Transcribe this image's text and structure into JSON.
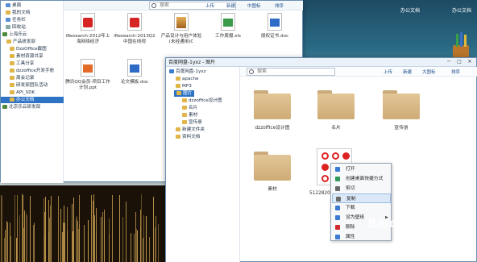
{
  "desktop": {
    "icon_label_1": "办公文档",
    "icon_label_2": "办公文档"
  },
  "win1": {
    "tree": [
      "桌面",
      "我的文档",
      "任务栏",
      "回收站",
      "上海乐云",
      "产品研发部",
      "DzzOffice截图",
      "素材资源共享",
      "工具分享",
      "dzzoffice开发手册",
      "周会记录",
      "研发部团队活动",
      "API_SDK",
      "办公文档",
      "北京乐云研发部"
    ],
    "search_placeholder": "搜索",
    "toolbar": [
      "上传",
      "新建",
      "中图标",
      "排序"
    ],
    "files": [
      {
        "name": "iResearch-2012年上海网络经济",
        "type": "pdf"
      },
      {
        "name": "iResearch-2013Q2中国在线视",
        "type": "pdf"
      },
      {
        "name": "产品设计与用户体验(未经通用)C",
        "type": "img"
      },
      {
        "name": "工作周报.xls",
        "type": "xls"
      },
      {
        "name": "授权证书.doc",
        "type": "docx"
      },
      {
        "name": "腾讯QQ会员-项目工作计划.ppt",
        "type": "ppt"
      },
      {
        "name": "论文模板.doc",
        "type": "docx"
      }
    ]
  },
  "win2": {
    "title": "百度网盘-1yxz - 图片",
    "controls": [
      "─",
      "□",
      "✕"
    ],
    "tree": [
      "百度网盘-1yxz",
      "apache",
      "MP3",
      "图片",
      "dzzoffice设计图",
      "名片",
      "素材",
      "宣传册",
      "新建文件夹",
      "资料文档"
    ],
    "search_placeholder": "搜索",
    "toolbar": [
      "上传",
      "新建",
      "大图标",
      "排序"
    ],
    "folders": [
      "dzzoffice设计图",
      "名片",
      "宣传册",
      "素材"
    ],
    "selected_file": "5122820"
  },
  "context_menu": {
    "items": [
      {
        "label": "打开",
        "icon": "open-icon",
        "color": "#3b7bd4"
      },
      {
        "label": "创建桌面快捷方式",
        "icon": "shortcut-icon",
        "color": "#2d9a57"
      },
      {
        "label": "剪切",
        "icon": "cut-icon",
        "color": "#6a6a6a"
      },
      {
        "label": "复制",
        "icon": "copy-icon",
        "color": "#6a6a6a"
      },
      {
        "label": "下载",
        "icon": "download-icon",
        "color": "#3b7bd4"
      },
      {
        "label": "设为壁纸",
        "icon": "wallpaper-icon",
        "color": "#3b7bd4"
      },
      {
        "label": "删除",
        "icon": "delete-icon",
        "color": "#d22a2a"
      },
      {
        "label": "属性",
        "icon": "properties-icon",
        "color": "#3b7bd4"
      }
    ],
    "submenu_arrow": "▶"
  },
  "watermark": "Baidu"
}
